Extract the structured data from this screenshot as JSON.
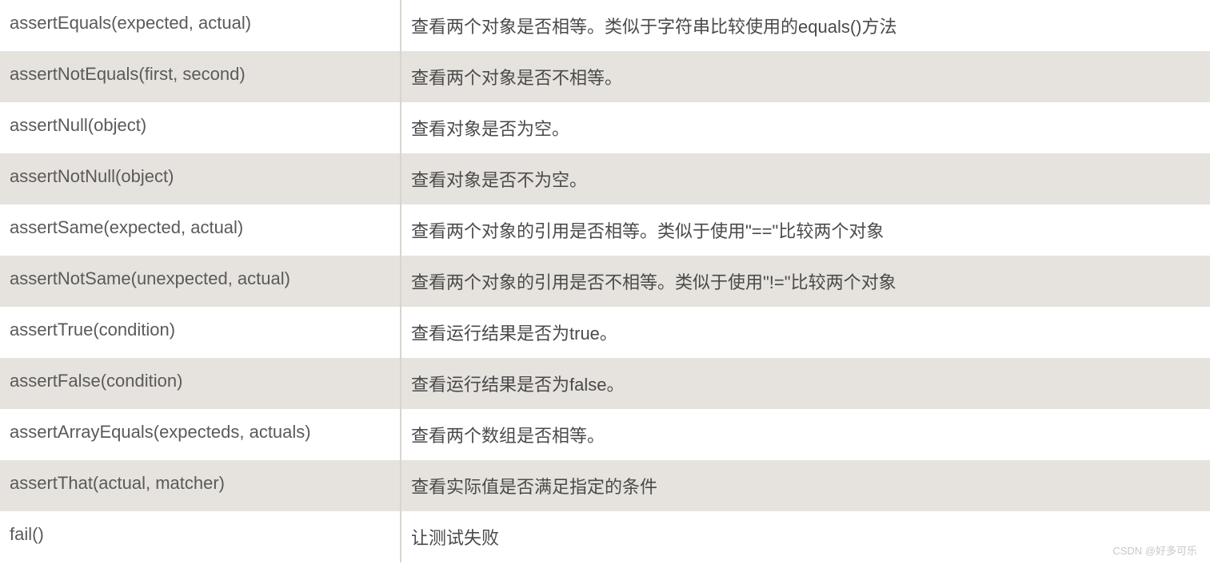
{
  "rows": [
    {
      "method": "assertEquals(expected, actual)",
      "description": "查看两个对象是否相等。类似于字符串比较使用的equals()方法"
    },
    {
      "method": "assertNotEquals(first, second)",
      "description": "查看两个对象是否不相等。"
    },
    {
      "method": "assertNull(object)",
      "description": "查看对象是否为空。"
    },
    {
      "method": "assertNotNull(object)",
      "description": "查看对象是否不为空。"
    },
    {
      "method": "assertSame(expected, actual)",
      "description": "查看两个对象的引用是否相等。类似于使用\"==\"比较两个对象"
    },
    {
      "method": "assertNotSame(unexpected, actual)",
      "description": "查看两个对象的引用是否不相等。类似于使用\"!=\"比较两个对象"
    },
    {
      "method": "assertTrue(condition)",
      "description": "查看运行结果是否为true。"
    },
    {
      "method": "assertFalse(condition)",
      "description": "查看运行结果是否为false。"
    },
    {
      "method": "assertArrayEquals(expecteds, actuals)",
      "description": "查看两个数组是否相等。"
    },
    {
      "method": "assertThat(actual, matcher)",
      "description": "查看实际值是否满足指定的条件"
    },
    {
      "method": "fail()",
      "description": "让测试失败"
    }
  ],
  "watermark": "CSDN @好多可乐"
}
